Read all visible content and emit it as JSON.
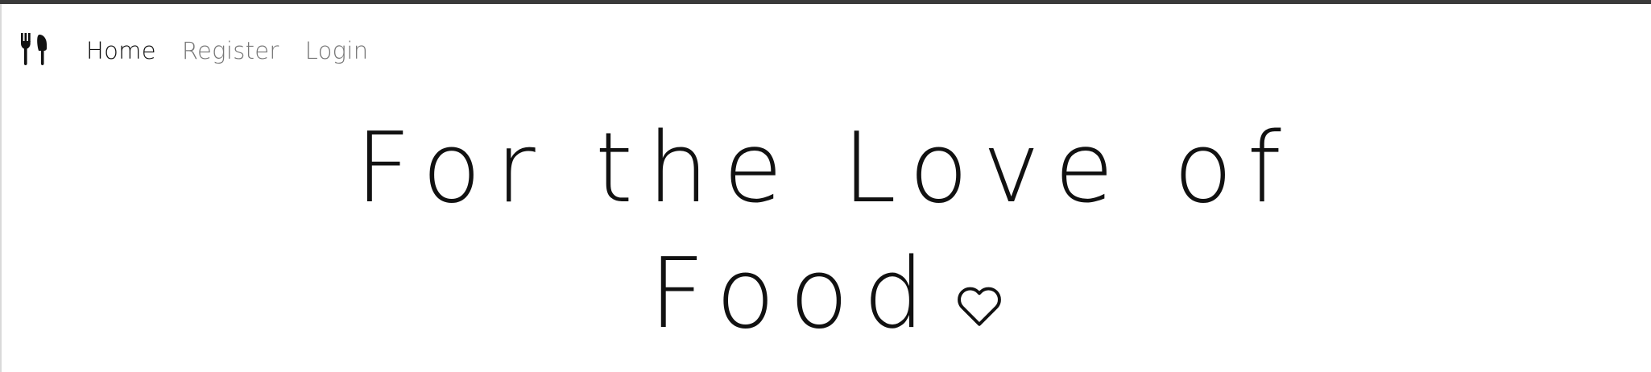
{
  "navbar": {
    "brand_icon": "fork-knife-icon",
    "links": [
      {
        "label": "Home",
        "active": true
      },
      {
        "label": "Register",
        "active": false
      },
      {
        "label": "Login",
        "active": false
      }
    ]
  },
  "hero": {
    "title_line_1": "For the Love of",
    "title_line_2": "Food",
    "decoration_icon": "heart-icon"
  },
  "colors": {
    "text_active": "#111111",
    "text_muted": "#777777",
    "top_border": "#3a3a3a",
    "background": "#ffffff"
  }
}
